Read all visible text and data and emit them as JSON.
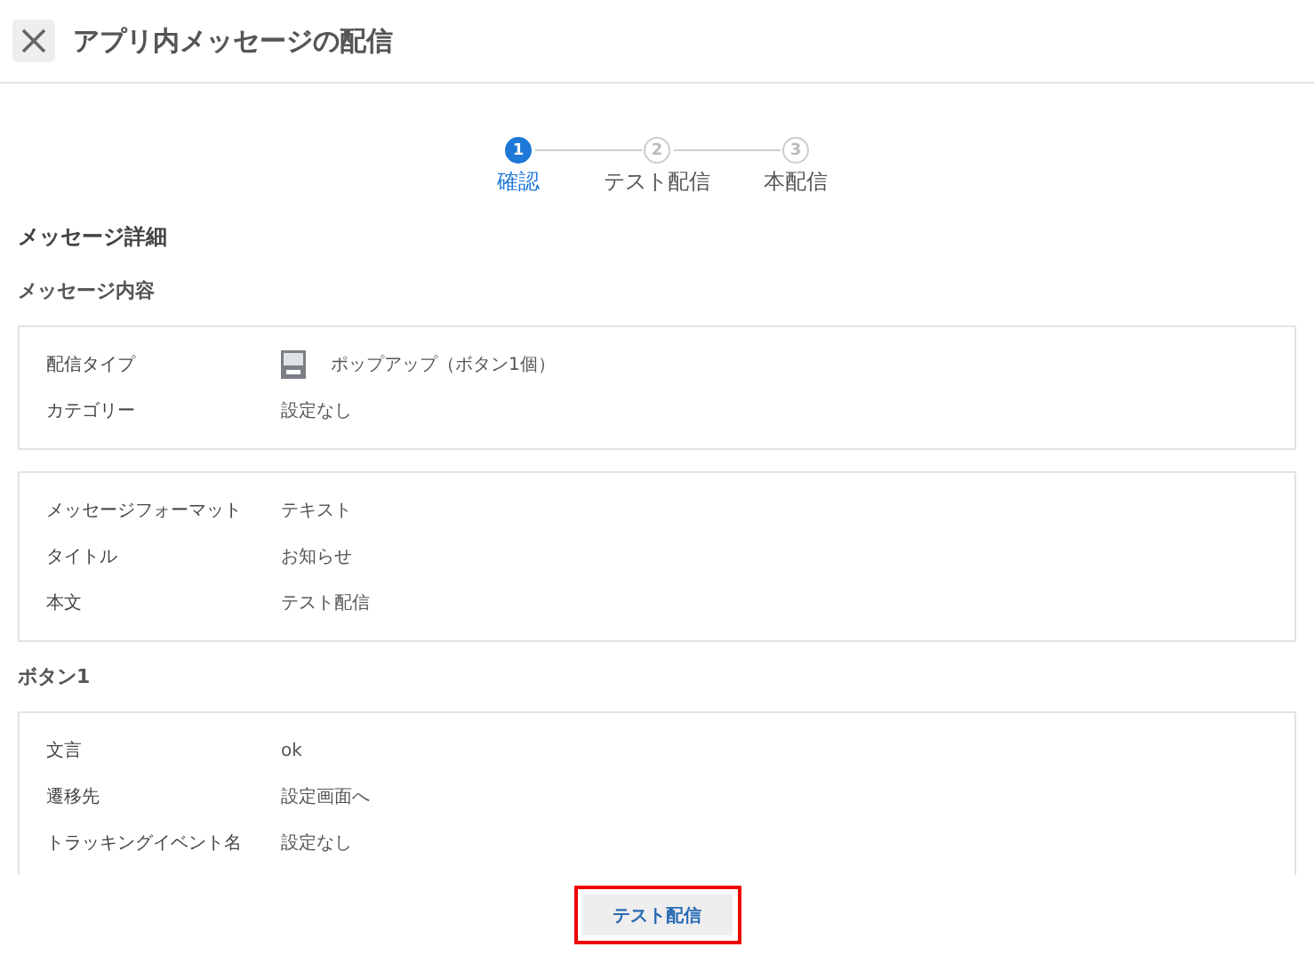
{
  "header": {
    "title": "アプリ内メッセージの配信"
  },
  "steps": [
    {
      "number": "1",
      "label": "確認",
      "selected": true
    },
    {
      "number": "2",
      "label": "テスト配信",
      "selected": false
    },
    {
      "number": "3",
      "label": "本配信",
      "selected": false
    }
  ],
  "page_title": "メッセージ詳細",
  "sections": [
    {
      "title": "メッセージ内容",
      "cards": [
        [
          {
            "label": "配信タイプ",
            "value": "ポップアップ（ボタン1個）",
            "icon": true
          },
          {
            "label": "カテゴリー",
            "value": "設定なし"
          }
        ],
        [
          {
            "label": "メッセージフォーマット",
            "value": "テキスト"
          },
          {
            "label": "タイトル",
            "value": "お知らせ"
          },
          {
            "label": "本文",
            "value": "テスト配信"
          }
        ]
      ]
    },
    {
      "title": "ボタン1",
      "cards": [
        [
          {
            "label": "文言",
            "value": "ok"
          },
          {
            "label": "遷移先",
            "value": "設定画面へ"
          },
          {
            "label": "トラッキングイベント名",
            "value": "設定なし"
          }
        ]
      ]
    }
  ],
  "footer_button": {
    "label": "テスト配信",
    "highlighted": true
  }
}
